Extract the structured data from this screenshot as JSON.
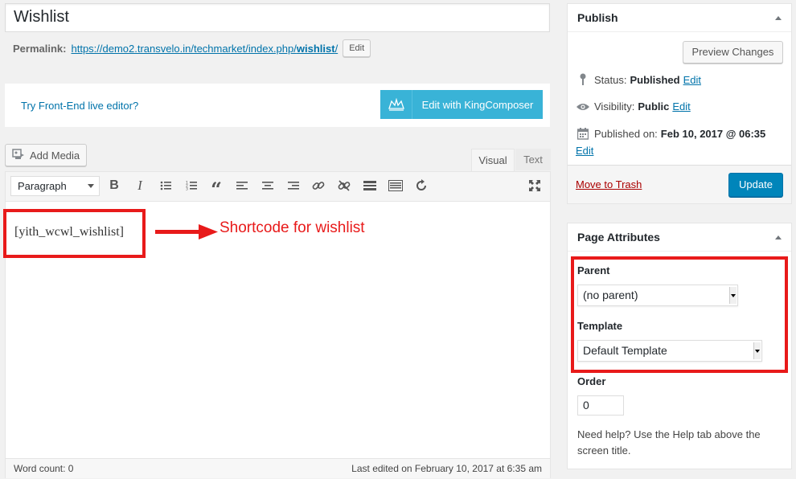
{
  "post": {
    "title": "Wishlist",
    "permalink_label": "Permalink:",
    "permalink_url_base": "https://demo2.transvelo.in/techmarket/index.php/",
    "permalink_slug": "wishlist",
    "permalink_trailing": "/",
    "permalink_edit": "Edit"
  },
  "kingcomposer": {
    "try_link": "Try Front-End live editor?",
    "button_label": "Edit with KingComposer",
    "icon": "crown-icon"
  },
  "editor": {
    "add_media": "Add Media",
    "tabs": [
      "Visual",
      "Text"
    ],
    "active_tab": "Visual",
    "format_select": "Paragraph",
    "toolbar_icons": [
      "bold-icon",
      "italic-icon",
      "bullet-list-icon",
      "numbered-list-icon",
      "blockquote-icon",
      "align-left-icon",
      "align-center-icon",
      "align-right-icon",
      "link-icon",
      "unlink-icon",
      "read-more-icon",
      "toolbar-toggle-icon",
      "refresh-icon",
      "fullscreen-icon"
    ],
    "content": "[yith_wcwl_wishlist]",
    "annotation": "Shortcode for wishlist",
    "annotation_color": "#e81a1a",
    "word_count": "Word count: 0",
    "last_edited": "Last edited on February 10, 2017 at 6:35 am"
  },
  "publish": {
    "heading": "Publish",
    "preview_button": "Preview Changes",
    "status_label": "Status:",
    "status_value": "Published",
    "visibility_label": "Visibility:",
    "visibility_value": "Public",
    "published_label": "Published on:",
    "published_value": "Feb 10, 2017 @ 06:35",
    "edit": "Edit",
    "trash": "Move to Trash",
    "update": "Update"
  },
  "page_attributes": {
    "heading": "Page Attributes",
    "parent_label": "Parent",
    "parent_value": "(no parent)",
    "template_label": "Template",
    "template_value": "Default Template",
    "order_label": "Order",
    "order_value": "0",
    "help": "Need help? Use the Help tab above the screen title."
  },
  "colors": {
    "accent": "#0073aa",
    "primary_button": "#0085ba",
    "kingcomposer": "#39b3d7",
    "highlight": "#e81a1a",
    "trash": "#aa0000"
  }
}
